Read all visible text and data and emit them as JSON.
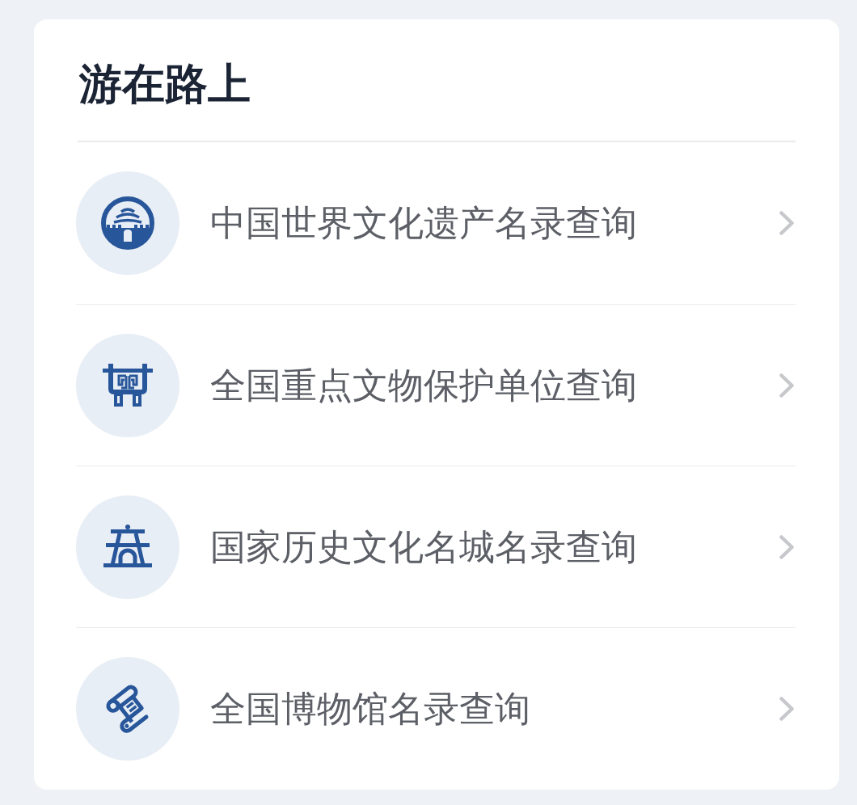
{
  "card": {
    "title": "游在路上",
    "items": [
      {
        "kind": "heritage",
        "label": "中国世界文化遗产名录查询"
      },
      {
        "kind": "relic",
        "label": "全国重点文物保护单位查询"
      },
      {
        "kind": "city",
        "label": "国家历史文化名城名录查询"
      },
      {
        "kind": "museum",
        "label": "全国博物馆名录查询"
      }
    ]
  }
}
